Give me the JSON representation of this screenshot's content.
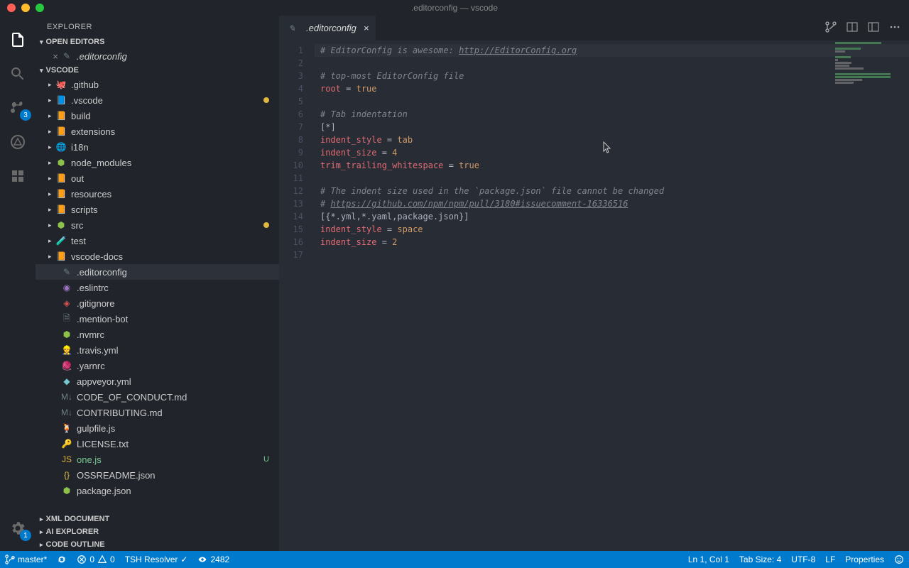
{
  "title": ".editorconfig — vscode",
  "activitybar": {
    "badge_scm": "3",
    "badge_settings": "1"
  },
  "sidebar": {
    "title": "EXPLORER",
    "sections": {
      "open_editors": "OPEN EDITORS",
      "project": "VSCODE",
      "xml": "XML DOCUMENT",
      "ai": "AI EXPLORER",
      "outline": "CODE OUTLINE"
    },
    "open_editor_file": ".editorconfig",
    "tree": [
      {
        "n": ".github",
        "k": "folder",
        "ic": "🐙",
        "cl": "ic-grey"
      },
      {
        "n": ".vscode",
        "k": "folder",
        "ic": "📘",
        "cl": "ic-blue",
        "mod": true
      },
      {
        "n": "build",
        "k": "folder",
        "ic": "📙",
        "cl": "ic-orange"
      },
      {
        "n": "extensions",
        "k": "folder",
        "ic": "📙",
        "cl": "ic-orange"
      },
      {
        "n": "i18n",
        "k": "folder",
        "ic": "🌐",
        "cl": "ic-cyan"
      },
      {
        "n": "node_modules",
        "k": "folder",
        "ic": "⬢",
        "cl": "ic-green"
      },
      {
        "n": "out",
        "k": "folder",
        "ic": "📙",
        "cl": "ic-orange"
      },
      {
        "n": "resources",
        "k": "folder",
        "ic": "📙",
        "cl": "ic-orange"
      },
      {
        "n": "scripts",
        "k": "folder",
        "ic": "📙",
        "cl": "ic-orange"
      },
      {
        "n": "src",
        "k": "folder",
        "ic": "⬢",
        "cl": "ic-green",
        "mod": true
      },
      {
        "n": "test",
        "k": "folder",
        "ic": "🧪",
        "cl": "ic-red"
      },
      {
        "n": "vscode-docs",
        "k": "folder",
        "ic": "📙",
        "cl": "ic-orange"
      },
      {
        "n": ".editorconfig",
        "k": "file",
        "ic": "✎",
        "cl": "ic-grey",
        "sel": true
      },
      {
        "n": ".eslintrc",
        "k": "file",
        "ic": "◉",
        "cl": "ic-purple"
      },
      {
        "n": ".gitignore",
        "k": "file",
        "ic": "◈",
        "cl": "ic-red"
      },
      {
        "n": ".mention-bot",
        "k": "file",
        "ic": "🗎",
        "cl": "ic-grey"
      },
      {
        "n": ".nvmrc",
        "k": "file",
        "ic": "⬢",
        "cl": "ic-green"
      },
      {
        "n": ".travis.yml",
        "k": "file",
        "ic": "👷",
        "cl": "ic-yel"
      },
      {
        "n": ".yarnrc",
        "k": "file",
        "ic": "🧶",
        "cl": "ic-blue"
      },
      {
        "n": "appveyor.yml",
        "k": "file",
        "ic": "◆",
        "cl": "ic-cyan"
      },
      {
        "n": "CODE_OF_CONDUCT.md",
        "k": "file",
        "ic": "M↓",
        "cl": "ic-grey"
      },
      {
        "n": "CONTRIBUTING.md",
        "k": "file",
        "ic": "M↓",
        "cl": "ic-grey"
      },
      {
        "n": "gulpfile.js",
        "k": "file",
        "ic": "🍹",
        "cl": "ic-red"
      },
      {
        "n": "LICENSE.txt",
        "k": "file",
        "ic": "🔑",
        "cl": "ic-yel"
      },
      {
        "n": "one.js",
        "k": "file",
        "ic": "JS",
        "cl": "ic-yel",
        "untracked": true,
        "deco": "U"
      },
      {
        "n": "OSSREADME.json",
        "k": "file",
        "ic": "{}",
        "cl": "ic-yel"
      },
      {
        "n": "package.json",
        "k": "file",
        "ic": "⬢",
        "cl": "ic-green"
      }
    ]
  },
  "tab": {
    "label": ".editorconfig"
  },
  "editor": {
    "lines": [
      [
        {
          "t": "# EditorConfig is awesome: ",
          "c": "tok-comment"
        },
        {
          "t": "http://EditorConfig.org",
          "c": "tok-link"
        }
      ],
      [],
      [
        {
          "t": "# top-most EditorConfig file",
          "c": "tok-comment"
        }
      ],
      [
        {
          "t": "root",
          "c": "tok-key"
        },
        {
          "t": " = ",
          "c": "tok-op"
        },
        {
          "t": "true",
          "c": "tok-val"
        }
      ],
      [],
      [
        {
          "t": "# Tab indentation",
          "c": "tok-comment"
        }
      ],
      [
        {
          "t": "[*]",
          "c": "tok-sec"
        }
      ],
      [
        {
          "t": "indent_style",
          "c": "tok-key"
        },
        {
          "t": " = ",
          "c": "tok-op"
        },
        {
          "t": "tab",
          "c": "tok-val"
        }
      ],
      [
        {
          "t": "indent_size",
          "c": "tok-key"
        },
        {
          "t": " = ",
          "c": "tok-op"
        },
        {
          "t": "4",
          "c": "tok-val"
        }
      ],
      [
        {
          "t": "trim_trailing_whitespace",
          "c": "tok-key"
        },
        {
          "t": " = ",
          "c": "tok-op"
        },
        {
          "t": "true",
          "c": "tok-val"
        }
      ],
      [],
      [
        {
          "t": "# The indent size used in the `package.json` file cannot be changed",
          "c": "tok-comment"
        }
      ],
      [
        {
          "t": "# ",
          "c": "tok-comment"
        },
        {
          "t": "https://github.com/npm/npm/pull/3180#issuecomment-16336516",
          "c": "tok-link"
        }
      ],
      [
        {
          "t": "[{*.yml,*.yaml,package.json}]",
          "c": "tok-sec"
        }
      ],
      [
        {
          "t": "indent_style",
          "c": "tok-key"
        },
        {
          "t": " = ",
          "c": "tok-op"
        },
        {
          "t": "space",
          "c": "tok-val"
        }
      ],
      [
        {
          "t": "indent_size",
          "c": "tok-key"
        },
        {
          "t": " = ",
          "c": "tok-op"
        },
        {
          "t": "2",
          "c": "tok-val"
        }
      ],
      []
    ]
  },
  "statusbar": {
    "branch": "master*",
    "errors": "0",
    "warnings": "0",
    "resolver": "TSH Resolver",
    "views": "2482",
    "ln_col": "Ln 1, Col 1",
    "tab_size": "Tab Size: 4",
    "encoding": "UTF-8",
    "eol": "LF",
    "lang": "Properties"
  }
}
